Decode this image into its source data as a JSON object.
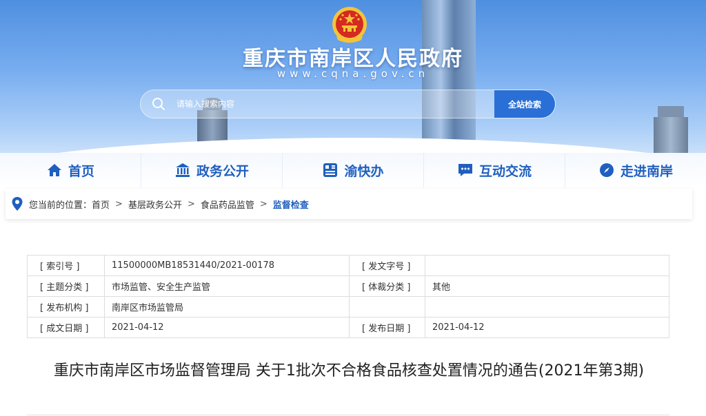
{
  "header": {
    "site_title": "重庆市南岸区人民政府",
    "site_url": "www.cqna.gov.cn"
  },
  "search": {
    "placeholder": "请输入搜索内容",
    "button_label": "全站检索"
  },
  "nav": {
    "items": [
      {
        "label": "首页",
        "icon": "home-icon"
      },
      {
        "label": "政务公开",
        "icon": "government-building-icon"
      },
      {
        "label": "渝快办",
        "icon": "service-grid-icon"
      },
      {
        "label": "互动交流",
        "icon": "chat-icon"
      },
      {
        "label": "走进南岸",
        "icon": "compass-icon"
      }
    ]
  },
  "breadcrumb": {
    "prefix": "您当前的位置：",
    "items": [
      "首页",
      "基层政务公开",
      "食品药品监管"
    ],
    "current": "监督检查",
    "separator": ">"
  },
  "meta": {
    "rows": [
      {
        "k1": "[ 索引号 ]",
        "v1": "11500000MB18531440/2021-00178",
        "k2": "[ 发文字号 ]",
        "v2": ""
      },
      {
        "k1": "[ 主题分类 ]",
        "v1": "市场监管、安全生产监管",
        "k2": "[ 体裁分类 ]",
        "v2": "其他"
      },
      {
        "k1": "[ 发布机构 ]",
        "v1": "南岸区市场监管局",
        "k2": "",
        "v2": ""
      },
      {
        "k1": "[ 成文日期 ]",
        "v1": "2021-04-12",
        "k2": "[ 发布日期 ]",
        "v2": "2021-04-12"
      }
    ]
  },
  "article": {
    "title": "重庆市南岸区市场监督管理局 关于1批次不合格食品核查处置情况的通告(2021年第3期)"
  },
  "colors": {
    "brand_blue": "#1f5fbf",
    "button_blue": "#2a6fd6",
    "emblem_red": "#d42a20",
    "emblem_gold": "#f3c43a"
  }
}
